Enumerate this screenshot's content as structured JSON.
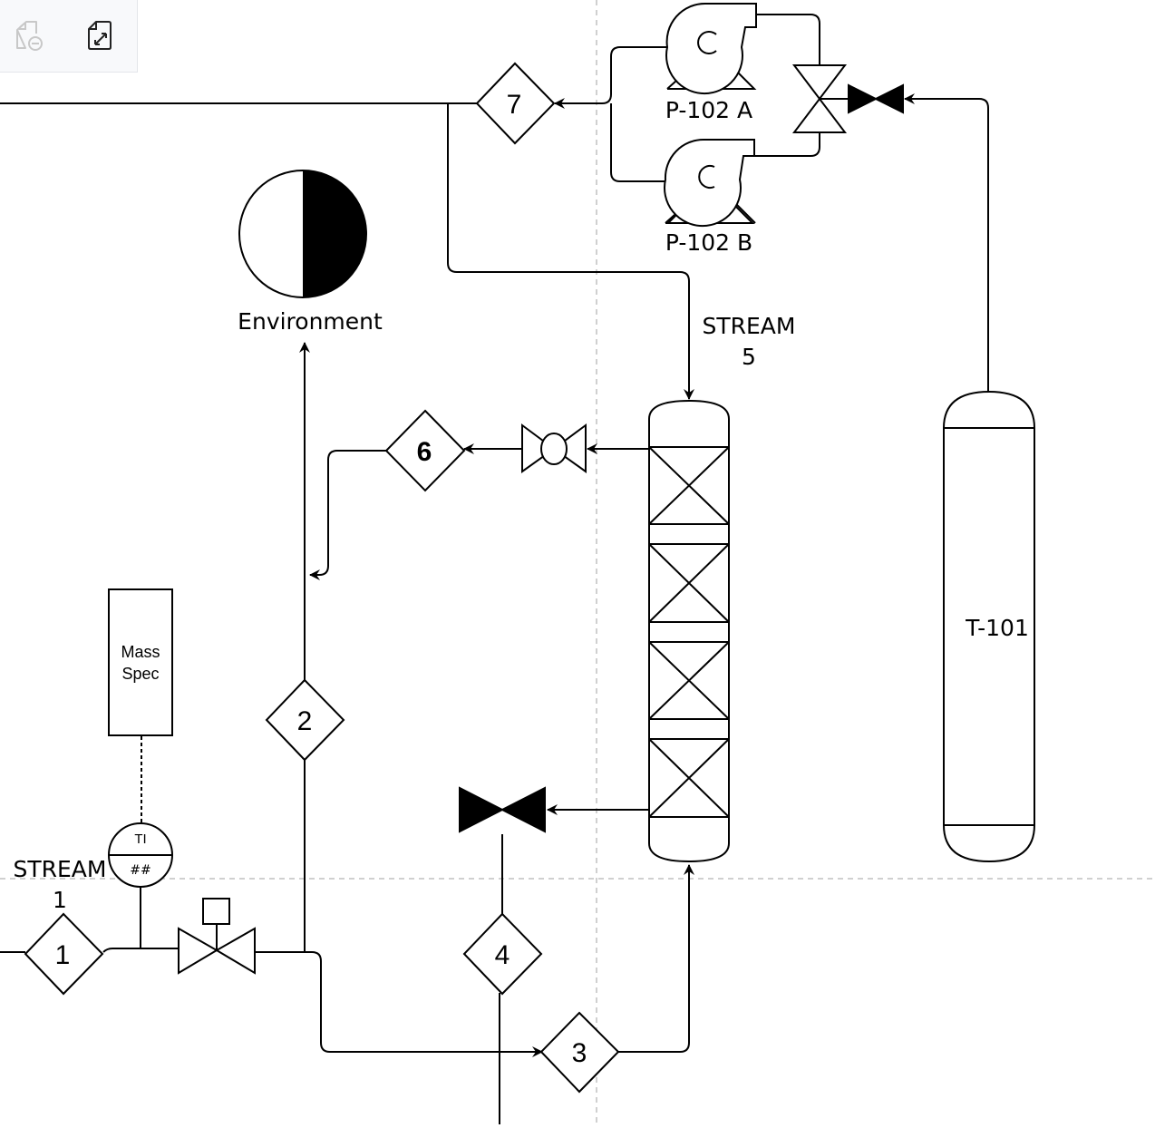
{
  "toolbar": {
    "buttons": [
      {
        "name": "remove-page",
        "icon": "page-minus-icon",
        "enabled": false
      },
      {
        "name": "fit-page",
        "icon": "page-expand-icon",
        "enabled": true
      }
    ]
  },
  "diagram": {
    "equipment": {
      "pump_a": "P-102 A",
      "pump_b": "P-102 B",
      "tank": "T-101",
      "environment": "Environment",
      "mass_spec": [
        "Mass",
        "Spec"
      ],
      "instrument_top": "TI",
      "instrument_bottom": "##"
    },
    "streams": {
      "stream1": [
        "STREAM",
        "1"
      ],
      "stream5": [
        "STREAM",
        "5"
      ]
    },
    "stream_markers": [
      "1",
      "2",
      "3",
      "4",
      "6",
      "7"
    ],
    "colors": {
      "line": "#000000",
      "guide": "#c0c0c0",
      "toolbar_bg": "#f8f9fb"
    }
  }
}
